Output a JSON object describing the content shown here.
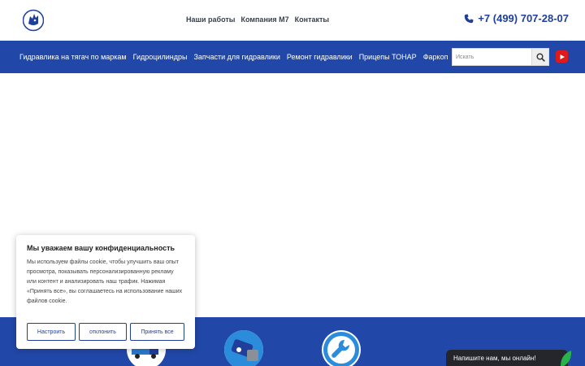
{
  "header": {
    "logo_icon": "rhino-logo-icon",
    "nav": [
      {
        "label": "Наши работы"
      },
      {
        "label": "Компания М7"
      },
      {
        "label": "Контакты"
      }
    ],
    "phone": "+7 (499) 707-28-07",
    "phone_icon": "phone-icon"
  },
  "main_nav": {
    "items": [
      {
        "label": "Гидравлика на тягач по маркам"
      },
      {
        "label": "Гидроцилиндры"
      },
      {
        "label": "Запчасти для гидравлики"
      },
      {
        "label": "Ремонт гидравлики"
      },
      {
        "label": "Прицепы ТОНАР"
      },
      {
        "label": "Фаркоп"
      }
    ],
    "search": {
      "placeholder": "Искать",
      "value": ""
    },
    "search_icon": "search-icon",
    "youtube_icon": "youtube-icon"
  },
  "features": [
    {
      "icon": "truck-icon"
    },
    {
      "icon": "hydraulic-part-icon"
    },
    {
      "icon": "wrench-icon"
    }
  ],
  "cookie_banner": {
    "title": "Мы уважаем вашу конфиденциальность",
    "text": "Мы используем файлы cookie, чтобы улучшить ваш опыт просмотра, показывать персонализированную рекламу или контент и анализировать наш трафик. Нажимая «Принять все», вы соглашаетесь на использование наших файлов cookie.",
    "buttons": {
      "customize": "Настроить",
      "reject": "отклонить",
      "accept_all": "Принять все"
    }
  },
  "chat": {
    "label": "Напишите нам, мы онлайн!"
  },
  "colors": {
    "brand_blue": "#2148a8",
    "text_blue": "#1f3f9b",
    "youtube_red": "#e01919",
    "chat_bg": "#24262c",
    "chat_accent": "#27b34a"
  }
}
